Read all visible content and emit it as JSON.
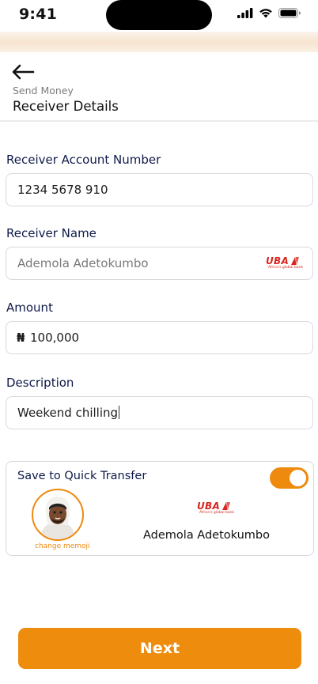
{
  "status_bar": {
    "time": "9:41"
  },
  "header": {
    "back_icon": "arrow-left-icon",
    "breadcrumb": "Send Money",
    "title": "Receiver Details"
  },
  "form": {
    "account_number": {
      "label": "Receiver Account Number",
      "value": "1234 5678 910"
    },
    "receiver_name": {
      "label": "Receiver Name",
      "value": "Ademola Adetokumbo",
      "bank_logo_text": "UBA",
      "bank_logo_tagline": "Africa's global bank"
    },
    "amount": {
      "label": "Amount",
      "currency_symbol": "₦",
      "value": "100,000"
    },
    "description": {
      "label": "Description",
      "value": "Weekend chilling"
    }
  },
  "quick_transfer": {
    "title": "Save to Quick Transfer",
    "toggle_on": true,
    "change_memoji_label": "change memoji",
    "bank_logo_text": "UBA",
    "bank_logo_tagline": "Africa's global bank",
    "receiver_name": "Ademola Adetokumbo"
  },
  "actions": {
    "next_label": "Next"
  },
  "colors": {
    "accent": "#ee8c0e",
    "label": "#0e1a4a",
    "uba_red": "#d8261f"
  }
}
